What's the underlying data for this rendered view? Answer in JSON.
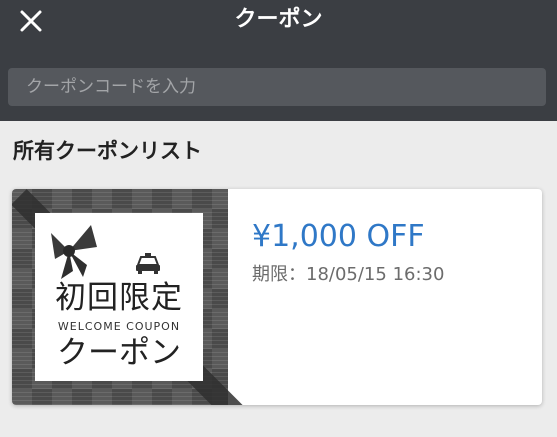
{
  "header": {
    "title": "クーポン",
    "close_icon": "close-icon"
  },
  "search": {
    "placeholder": "クーポンコードを入力"
  },
  "section": {
    "title": "所有クーポンリスト"
  },
  "coupons": [
    {
      "image_title": "初回限定",
      "image_subtitle": "WELCOME COUPON",
      "image_kana": "クーポン",
      "amount": "¥1,000 OFF",
      "expiry": "期限：18/05/15 16:30"
    }
  ],
  "colors": {
    "header_bg": "#3b3e43",
    "amount": "#2f78c7",
    "page_bg": "#ececec"
  }
}
